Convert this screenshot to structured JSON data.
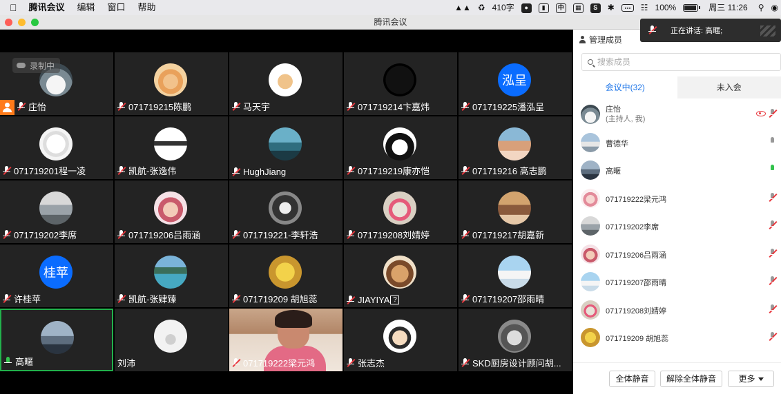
{
  "menubar": {
    "app": "腾讯会议",
    "menus": [
      "编辑",
      "窗口",
      "帮助"
    ],
    "word_count": "410字",
    "ime_label": "中",
    "battery_pct": "100%",
    "clock": "周三 11:26"
  },
  "window": {
    "title": "腾讯会议"
  },
  "recording": {
    "label": "录制中"
  },
  "speaking": {
    "label": "正在讲话: 高暱;"
  },
  "tiles": [
    {
      "name": "庄怡",
      "avatar": "cat",
      "host": true
    },
    {
      "name": "071719215陈鹏",
      "avatar": "baby"
    },
    {
      "name": "马天宇",
      "avatar": "kitten"
    },
    {
      "name": "071719214卞嘉炜",
      "avatar": "dark"
    },
    {
      "name": "071719225潘泓呈",
      "avatar_text": "泓呈"
    },
    {
      "name": "071719201程一凌",
      "avatar": "sketch"
    },
    {
      "name": "凯航-张逸伟",
      "avatar": "logo"
    },
    {
      "name": "HughJiang",
      "avatar": "sea"
    },
    {
      "name": "071719219康亦恺",
      "avatar": "anime"
    },
    {
      "name": "071719216 高志鹏",
      "avatar": "girl"
    },
    {
      "name": "071719202李席",
      "avatar": "car"
    },
    {
      "name": "071719206吕雨涵",
      "avatar": "flower-girl"
    },
    {
      "name": "071719221-李轩浩",
      "avatar": "gamer"
    },
    {
      "name": "071719208刘婧婷",
      "avatar": "pink"
    },
    {
      "name": "071719217胡嘉新",
      "avatar": "face"
    },
    {
      "name": "许桂苹",
      "avatar_text": "桂苹"
    },
    {
      "name": "凯航-张肄臻",
      "avatar": "lake"
    },
    {
      "name": "071719209 胡旭蕊",
      "avatar": "yellow"
    },
    {
      "name": "JIAYIYA",
      "avatar": "dog",
      "badge": "?"
    },
    {
      "name": "071719207邵雨晴",
      "avatar": "bunny"
    },
    {
      "name": "高暱",
      "avatar": "silhouette",
      "mic_on": true,
      "active": true
    },
    {
      "name": "刘沛",
      "avatar": "mist",
      "no_mic": true
    },
    {
      "name": "071719222梁元鸿",
      "camera": true
    },
    {
      "name": "张志杰",
      "avatar": "cartoon-boy"
    },
    {
      "name": "SKD厨房设计顾问胡...",
      "avatar": "hands"
    }
  ],
  "panel": {
    "header": "管理成员",
    "search_placeholder": "搜索成员",
    "tab_in": "会议中(32)",
    "tab_out": "未入会",
    "members": [
      {
        "name": "庄怡",
        "sub": "(主持人, 我)",
        "mic": "muted",
        "avatar": "cat"
      },
      {
        "name": "曹德华",
        "mic": "off",
        "avatar": "tent"
      },
      {
        "name": "高暱",
        "mic": "on",
        "avatar": "silhouette"
      },
      {
        "name": "071719222梁元鸿",
        "mic": "muted",
        "avatar": "pinkgirl"
      },
      {
        "name": "071719202李席",
        "mic": "muted",
        "avatar": "car"
      },
      {
        "name": "071719206吕雨涵",
        "mic": "muted",
        "avatar": "flower-girl"
      },
      {
        "name": "071719207邵雨晴",
        "mic": "muted",
        "avatar": "bunny"
      },
      {
        "name": "071719208刘婧婷",
        "mic": "muted",
        "avatar": "pink"
      },
      {
        "name": "071719209 胡旭蕊",
        "mic": "muted",
        "avatar": "yellow"
      }
    ],
    "buttons": {
      "mute_all": "全体静音",
      "unmute_all": "解除全体静音",
      "more": "更多"
    }
  },
  "colors": {
    "accent": "#1a73e8",
    "active_border": "#22b14c",
    "host_badge": "#ff7a1a",
    "muted": "#e8373d"
  }
}
